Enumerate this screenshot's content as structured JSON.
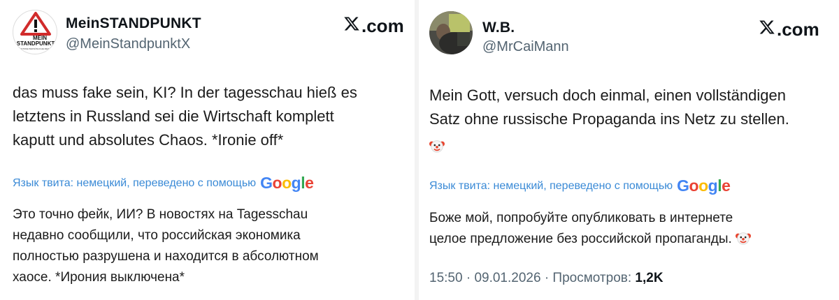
{
  "left_tweet": {
    "avatar_text": [
      "MEIN",
      "STANDPUNKT",
      "KEYSTONE PERSÖNLICHE MEINUNG"
    ],
    "display_name": "MeinSTANDPUNKT",
    "handle": "@MeinStandpunktX",
    "brand": ".com",
    "text_lines": [
      "das muss fake sein, KI? In der tagesschau hieß es",
      "letztens in Russland sei die Wirtschaft komplett",
      "kaputt und absolutes Chaos. *Ironie off*"
    ],
    "translate_label": "Язык твита: немецкий, переведено с помощью",
    "translation_lines": [
      "Это точно фейк, ИИ? В новостях на Tagesschau",
      "недавно сообщили, что российская экономика",
      "полностью разрушена и находится в абсолютном",
      "хаосе. *Ирония выключена*"
    ]
  },
  "right_tweet": {
    "display_name": "W.B.",
    "handle": "@MrCaiMann",
    "brand": ".com",
    "text_lines": [
      "Mein Gott, versuch doch einmal, einen vollständigen",
      "Satz ohne russische Propaganda ins Netz zu stellen."
    ],
    "translate_label": "Язык твита: немецкий, переведено с помощью",
    "translation_lines": [
      "Боже мой, попробуйте опубликовать в интернете",
      "целое предложение без российской пропаганды."
    ],
    "time": "15:50",
    "date": "09.01.2026",
    "views_label": "Просмотров:",
    "views_count": "1,2K"
  },
  "google_logo": [
    "G",
    "o",
    "o",
    "g",
    "l",
    "e"
  ],
  "separator": "·",
  "icons": {
    "x_logo": "x-logo-icon",
    "clown": "clown-face-icon"
  },
  "colors": {
    "link_blue": "#3a8ad6",
    "muted": "#536471",
    "text": "#0f1419"
  }
}
